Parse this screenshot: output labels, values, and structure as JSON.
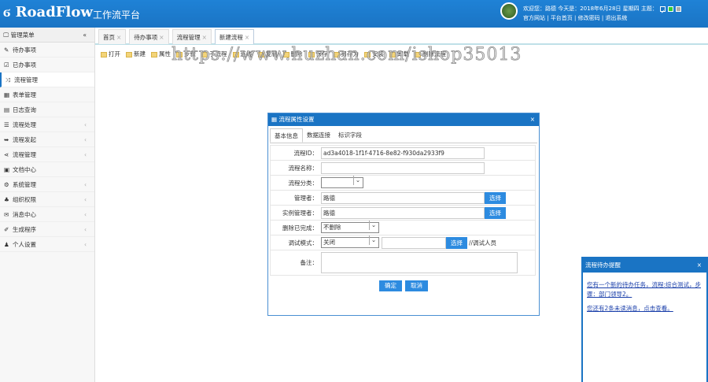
{
  "header": {
    "logo": "RoadFlow",
    "title": "工作流平台",
    "welcome": "欢迎您：路德 今天是：2018年6月28日 星期四 主题：",
    "links": [
      "官方网站",
      "平台首页",
      "修改密码",
      "退出系统"
    ]
  },
  "sidebar": {
    "title": "管理菜单",
    "collapse": "«",
    "items": [
      {
        "label": "待办事项",
        "icon": "✎",
        "sub": false
      },
      {
        "label": "已办事项",
        "icon": "☑",
        "sub": false
      },
      {
        "label": "流程管理",
        "icon": "⤨",
        "sub": false,
        "active": true
      },
      {
        "label": "表单管理",
        "icon": "▦",
        "sub": false
      },
      {
        "label": "日志查询",
        "icon": "▤",
        "sub": false
      },
      {
        "label": "流程处理",
        "icon": "☰",
        "sub": true
      },
      {
        "label": "流程发起",
        "icon": "➥",
        "sub": true
      },
      {
        "label": "流程管理",
        "icon": "⋖",
        "sub": true
      },
      {
        "label": "文档中心",
        "icon": "▣",
        "sub": false
      },
      {
        "label": "系统管理",
        "icon": "⚙",
        "sub": true
      },
      {
        "label": "组织权限",
        "icon": "♣",
        "sub": true
      },
      {
        "label": "消息中心",
        "icon": "✉",
        "sub": true
      },
      {
        "label": "生成程序",
        "icon": "✐",
        "sub": true
      },
      {
        "label": "个人设置",
        "icon": "♟",
        "sub": true
      }
    ]
  },
  "tabs": [
    {
      "label": "首页"
    },
    {
      "label": "待办事项"
    },
    {
      "label": "流程管理"
    },
    {
      "label": "新建流程",
      "active": true
    }
  ],
  "toolbar": [
    "打开",
    "新建",
    "属性",
    "步骤",
    "子流程",
    "连线",
    "复制",
    "删除",
    "保存",
    "另存为",
    "安装",
    "卸载",
    "删除流程"
  ],
  "watermark": "https://www.huzhan.com/ishop35013",
  "dialog": {
    "title": "流程属性设置",
    "tabs": [
      "基本信息",
      "数据连接",
      "标识字段"
    ],
    "fields": {
      "id_label": "流程ID：",
      "id_value": "ad3a4018-1f1f-4716-8e82-f930da2933f9",
      "name_label": "流程名称：",
      "name_value": "",
      "type_label": "流程分类：",
      "type_value": "",
      "manager_label": "管理者：",
      "manager_value": "路德",
      "instance_label": "实例管理者：",
      "instance_value": "路德",
      "delete_label": "删除已完成：",
      "delete_value": "不删除",
      "debug_label": "调试模式：",
      "debug_value": "关闭",
      "debug_hint": "//调试人员",
      "note_label": "备注："
    },
    "select_label": "选择",
    "ok": "确定",
    "cancel": "取消"
  },
  "popup": {
    "title": "流程待办提醒",
    "msg1": "您有一个新的待办任务，流程:综合测试，步骤：部门领导2。",
    "msg2": "您还有2条未读消息，点击查看。"
  }
}
